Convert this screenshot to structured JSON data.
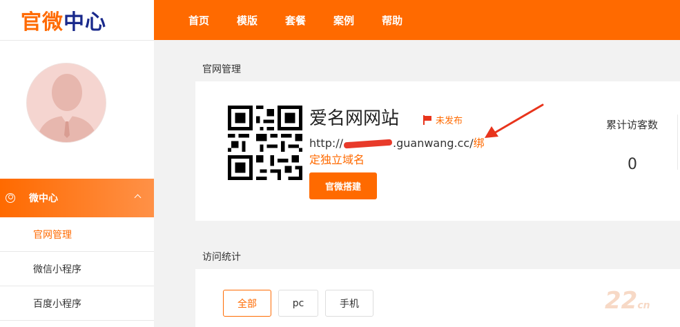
{
  "logo": {
    "part1": "官微",
    "part2": "中心"
  },
  "topnav": [
    "首页",
    "模版",
    "套餐",
    "案例",
    "帮助"
  ],
  "sidebar": {
    "active_label": "微中心",
    "items": [
      "官网管理",
      "微信小程序",
      "百度小程序"
    ]
  },
  "main": {
    "section1_title": "官网管理",
    "site_name": "爱名网网站",
    "status": "未发布",
    "url_prefix": "http://",
    "url_suffix": ".guanwang.cc/",
    "bind_part1": "绑",
    "bind_part2": "定独立域名",
    "build_button": "官微搭建",
    "visitors_label": "累计访客数",
    "visitors_value": "0",
    "section2_title": "访问统计",
    "tabs": [
      "全部",
      "pc",
      "手机"
    ]
  },
  "watermark": {
    "big": "22",
    "small": "cn"
  },
  "colors": {
    "accent": "#ff6a00",
    "logo_blue": "#1a2a8c",
    "annotation": "#e8341c"
  }
}
